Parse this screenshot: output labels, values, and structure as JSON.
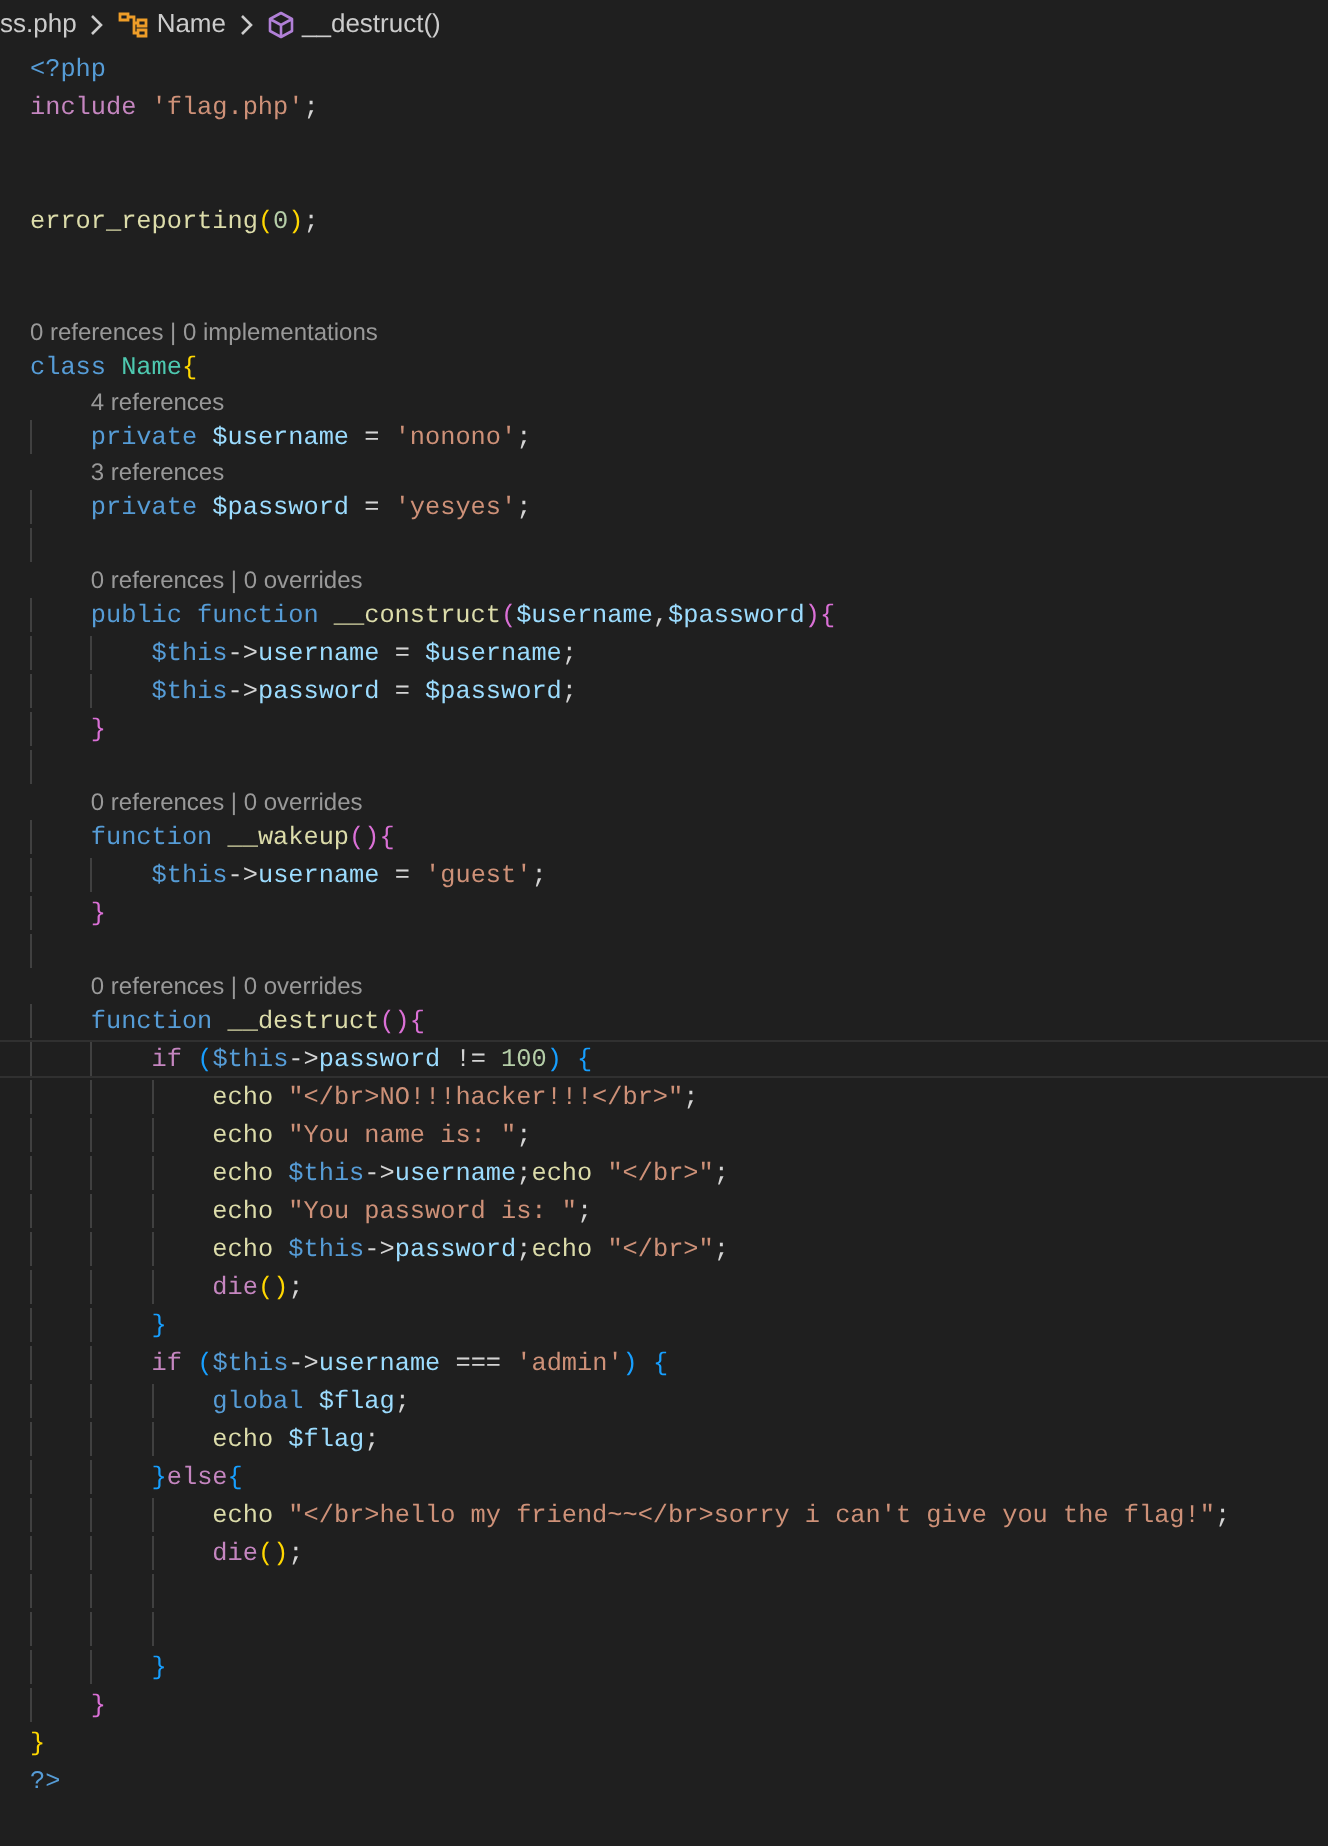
{
  "breadcrumbs": [
    {
      "kind": "file",
      "text": "ss.php"
    },
    {
      "kind": "class",
      "text": "Name"
    },
    {
      "kind": "method",
      "text": "__destruct()"
    }
  ],
  "lines": [
    {
      "kind": "code",
      "current": false,
      "tokens": [
        {
          "kind": "kw",
          "text": "<?php"
        }
      ]
    },
    {
      "kind": "code",
      "current": false,
      "tokens": [
        {
          "kind": "ctrl",
          "text": "include "
        },
        {
          "kind": "str",
          "text": "'flag.php'"
        },
        {
          "kind": "p",
          "text": ";"
        }
      ]
    },
    {
      "kind": "blank"
    },
    {
      "kind": "blank"
    },
    {
      "kind": "code",
      "current": false,
      "tokens": [
        {
          "kind": "fn",
          "text": "error_reporting"
        },
        {
          "kind": "b1",
          "text": "("
        },
        {
          "kind": "num",
          "text": "0"
        },
        {
          "kind": "b1",
          "text": ")"
        },
        {
          "kind": "p",
          "text": ";"
        }
      ]
    },
    {
      "kind": "blank"
    },
    {
      "kind": "blank"
    },
    {
      "kind": "lens",
      "text": "0 references | 0 implementations"
    },
    {
      "kind": "code",
      "current": false,
      "tokens": [
        {
          "kind": "kw",
          "text": "class "
        },
        {
          "kind": "cls",
          "text": "Name"
        },
        {
          "kind": "b1",
          "text": "{"
        }
      ],
      "children": [
        {
          "kind": "lens",
          "text": "4 references"
        },
        {
          "kind": "code",
          "current": false,
          "tokens": [
            {
              "kind": "kw",
              "text": "private "
            },
            {
              "kind": "var",
              "text": "$username"
            },
            {
              "kind": "p",
              "text": " = "
            },
            {
              "kind": "str",
              "text": "'nonono'"
            },
            {
              "kind": "p",
              "text": ";"
            }
          ]
        },
        {
          "kind": "lens",
          "text": "3 references"
        },
        {
          "kind": "code",
          "current": false,
          "tokens": [
            {
              "kind": "kw",
              "text": "private "
            },
            {
              "kind": "var",
              "text": "$password"
            },
            {
              "kind": "p",
              "text": " = "
            },
            {
              "kind": "str",
              "text": "'yesyes'"
            },
            {
              "kind": "p",
              "text": ";"
            }
          ]
        },
        {
          "kind": "blank"
        },
        {
          "kind": "lens",
          "text": "0 references | 0 overrides"
        },
        {
          "kind": "code",
          "current": false,
          "tokens": [
            {
              "kind": "kw",
              "text": "public function "
            },
            {
              "kind": "fn",
              "text": "__construct"
            },
            {
              "kind": "b2",
              "text": "("
            },
            {
              "kind": "var",
              "text": "$username"
            },
            {
              "kind": "p",
              "text": ","
            },
            {
              "kind": "var",
              "text": "$password"
            },
            {
              "kind": "b2",
              "text": "){"
            }
          ],
          "children": [
            {
              "kind": "code",
              "current": false,
              "tokens": [
                {
                  "kind": "kw",
                  "text": "$this"
                },
                {
                  "kind": "p",
                  "text": "->"
                },
                {
                  "kind": "var",
                  "text": "username"
                },
                {
                  "kind": "p",
                  "text": " = "
                },
                {
                  "kind": "var",
                  "text": "$username"
                },
                {
                  "kind": "p",
                  "text": ";"
                }
              ]
            },
            {
              "kind": "code",
              "current": false,
              "tokens": [
                {
                  "kind": "kw",
                  "text": "$this"
                },
                {
                  "kind": "p",
                  "text": "->"
                },
                {
                  "kind": "var",
                  "text": "password"
                },
                {
                  "kind": "p",
                  "text": " = "
                },
                {
                  "kind": "var",
                  "text": "$password"
                },
                {
                  "kind": "p",
                  "text": ";"
                }
              ]
            }
          ]
        },
        {
          "kind": "code",
          "current": false,
          "tokens": [
            {
              "kind": "b2",
              "text": "}"
            }
          ]
        },
        {
          "kind": "blank"
        },
        {
          "kind": "lens",
          "text": "0 references | 0 overrides"
        },
        {
          "kind": "code",
          "current": false,
          "tokens": [
            {
              "kind": "kw",
              "text": "function "
            },
            {
              "kind": "fn",
              "text": "__wakeup"
            },
            {
              "kind": "b2",
              "text": "(){"
            }
          ],
          "children": [
            {
              "kind": "code",
              "current": false,
              "tokens": [
                {
                  "kind": "kw",
                  "text": "$this"
                },
                {
                  "kind": "p",
                  "text": "->"
                },
                {
                  "kind": "var",
                  "text": "username"
                },
                {
                  "kind": "p",
                  "text": " = "
                },
                {
                  "kind": "str",
                  "text": "'guest'"
                },
                {
                  "kind": "p",
                  "text": ";"
                }
              ]
            }
          ]
        },
        {
          "kind": "code",
          "current": false,
          "tokens": [
            {
              "kind": "b2",
              "text": "}"
            }
          ]
        },
        {
          "kind": "blank"
        },
        {
          "kind": "lens",
          "text": "0 references | 0 overrides"
        },
        {
          "kind": "code",
          "current": false,
          "tokens": [
            {
              "kind": "kw",
              "text": "function "
            },
            {
              "kind": "fn",
              "text": "__destruct"
            },
            {
              "kind": "b2",
              "text": "(){"
            }
          ],
          "children": [
            {
              "kind": "code",
              "current": true,
              "tokens": [
                {
                  "kind": "ctrl",
                  "text": "if "
                },
                {
                  "kind": "b3",
                  "text": "("
                },
                {
                  "kind": "kw",
                  "text": "$this"
                },
                {
                  "kind": "p",
                  "text": "->"
                },
                {
                  "kind": "var",
                  "text": "password"
                },
                {
                  "kind": "p",
                  "text": " != "
                },
                {
                  "kind": "num",
                  "text": "100"
                },
                {
                  "kind": "b3",
                  "text": ") {"
                }
              ],
              "children": [
                {
                  "kind": "code",
                  "current": false,
                  "tokens": [
                    {
                      "kind": "fn",
                      "text": "echo "
                    },
                    {
                      "kind": "str",
                      "text": "\"</br>NO!!!hacker!!!</br>\""
                    },
                    {
                      "kind": "p",
                      "text": ";"
                    }
                  ]
                },
                {
                  "kind": "code",
                  "current": false,
                  "tokens": [
                    {
                      "kind": "fn",
                      "text": "echo "
                    },
                    {
                      "kind": "str",
                      "text": "\"You name is: \""
                    },
                    {
                      "kind": "p",
                      "text": ";"
                    }
                  ]
                },
                {
                  "kind": "code",
                  "current": false,
                  "tokens": [
                    {
                      "kind": "fn",
                      "text": "echo "
                    },
                    {
                      "kind": "kw",
                      "text": "$this"
                    },
                    {
                      "kind": "p",
                      "text": "->"
                    },
                    {
                      "kind": "var",
                      "text": "username"
                    },
                    {
                      "kind": "p",
                      "text": ";"
                    },
                    {
                      "kind": "fn",
                      "text": "echo "
                    },
                    {
                      "kind": "str",
                      "text": "\"</br>\""
                    },
                    {
                      "kind": "p",
                      "text": ";"
                    }
                  ]
                },
                {
                  "kind": "code",
                  "current": false,
                  "tokens": [
                    {
                      "kind": "fn",
                      "text": "echo "
                    },
                    {
                      "kind": "str",
                      "text": "\"You password is: \""
                    },
                    {
                      "kind": "p",
                      "text": ";"
                    }
                  ]
                },
                {
                  "kind": "code",
                  "current": false,
                  "tokens": [
                    {
                      "kind": "fn",
                      "text": "echo "
                    },
                    {
                      "kind": "kw",
                      "text": "$this"
                    },
                    {
                      "kind": "p",
                      "text": "->"
                    },
                    {
                      "kind": "var",
                      "text": "password"
                    },
                    {
                      "kind": "p",
                      "text": ";"
                    },
                    {
                      "kind": "fn",
                      "text": "echo "
                    },
                    {
                      "kind": "str",
                      "text": "\"</br>\""
                    },
                    {
                      "kind": "p",
                      "text": ";"
                    }
                  ]
                },
                {
                  "kind": "code",
                  "current": false,
                  "tokens": [
                    {
                      "kind": "ctrl",
                      "text": "die"
                    },
                    {
                      "kind": "b1",
                      "text": "()"
                    },
                    {
                      "kind": "p",
                      "text": ";"
                    }
                  ]
                }
              ]
            },
            {
              "kind": "code",
              "current": false,
              "tokens": [
                {
                  "kind": "b3",
                  "text": "}"
                }
              ]
            },
            {
              "kind": "code",
              "current": false,
              "tokens": [
                {
                  "kind": "ctrl",
                  "text": "if "
                },
                {
                  "kind": "b3",
                  "text": "("
                },
                {
                  "kind": "kw",
                  "text": "$this"
                },
                {
                  "kind": "p",
                  "text": "->"
                },
                {
                  "kind": "var",
                  "text": "username"
                },
                {
                  "kind": "p",
                  "text": " === "
                },
                {
                  "kind": "str",
                  "text": "'admin'"
                },
                {
                  "kind": "b3",
                  "text": ") {"
                }
              ],
              "children": [
                {
                  "kind": "code",
                  "current": false,
                  "tokens": [
                    {
                      "kind": "kw",
                      "text": "global "
                    },
                    {
                      "kind": "var",
                      "text": "$flag"
                    },
                    {
                      "kind": "p",
                      "text": ";"
                    }
                  ]
                },
                {
                  "kind": "code",
                  "current": false,
                  "tokens": [
                    {
                      "kind": "fn",
                      "text": "echo "
                    },
                    {
                      "kind": "var",
                      "text": "$flag"
                    },
                    {
                      "kind": "p",
                      "text": ";"
                    }
                  ]
                }
              ]
            },
            {
              "kind": "code",
              "current": false,
              "tokens": [
                {
                  "kind": "b3",
                  "text": "}"
                },
                {
                  "kind": "ctrl",
                  "text": "else"
                },
                {
                  "kind": "b3",
                  "text": "{"
                }
              ],
              "children": [
                {
                  "kind": "code",
                  "current": false,
                  "tokens": [
                    {
                      "kind": "fn",
                      "text": "echo "
                    },
                    {
                      "kind": "str",
                      "text": "\"</br>hello my friend~~</br>sorry i can't give you the flag!\""
                    },
                    {
                      "kind": "p",
                      "text": ";"
                    }
                  ]
                },
                {
                  "kind": "code",
                  "current": false,
                  "tokens": [
                    {
                      "kind": "ctrl",
                      "text": "die"
                    },
                    {
                      "kind": "b1",
                      "text": "()"
                    },
                    {
                      "kind": "p",
                      "text": ";"
                    }
                  ]
                },
                {
                  "kind": "blank"
                },
                {
                  "kind": "blank"
                }
              ]
            },
            {
              "kind": "code",
              "current": false,
              "tokens": [
                {
                  "kind": "b3",
                  "text": "}"
                }
              ]
            }
          ]
        },
        {
          "kind": "code",
          "current": false,
          "tokens": [
            {
              "kind": "b2",
              "text": "}"
            }
          ]
        }
      ]
    },
    {
      "kind": "code",
      "current": false,
      "tokens": [
        {
          "kind": "b1",
          "text": "}"
        }
      ]
    },
    {
      "kind": "code",
      "current": false,
      "tokens": [
        {
          "kind": "kw",
          "text": "?>"
        }
      ]
    }
  ]
}
